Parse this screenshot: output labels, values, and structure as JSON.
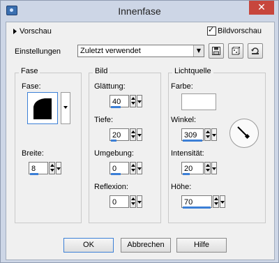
{
  "window": {
    "title": "Innenfase",
    "close_glyph": "✕"
  },
  "top": {
    "preview_label": "Vorschau",
    "preview_checkbox_label": "Bildvorschau",
    "preview_checked": true
  },
  "settings": {
    "label": "Einstellungen",
    "value": "Zuletzt verwendet",
    "icons": [
      "save-preset-icon",
      "dice-icon",
      "reset-icon"
    ]
  },
  "fase_group": {
    "title": "Fase",
    "fase_label": "Fase:",
    "breite_label": "Breite:",
    "breite_value": "8"
  },
  "bild_group": {
    "title": "Bild",
    "glaettung_label": "Glättung:",
    "glaettung_value": "40",
    "tiefe_label": "Tiefe:",
    "tiefe_value": "20",
    "umgebung_label": "Umgebung:",
    "umgebung_value": "0",
    "reflexion_label": "Reflexion:",
    "reflexion_value": "0"
  },
  "licht_group": {
    "title": "Lichtquelle",
    "farbe_label": "Farbe:",
    "farbe_color": "#ffffff",
    "winkel_label": "Winkel:",
    "winkel_value": "309",
    "intensitaet_label": "Intensität:",
    "intensitaet_value": "20",
    "hoehe_label": "Höhe:",
    "hoehe_value": "70"
  },
  "buttons": {
    "ok": "OK",
    "cancel": "Abbrechen",
    "help": "Hilfe"
  },
  "colors": {
    "accent": "#3b7fd6",
    "close": "#c7463c",
    "frame": "#cdd6e6"
  }
}
